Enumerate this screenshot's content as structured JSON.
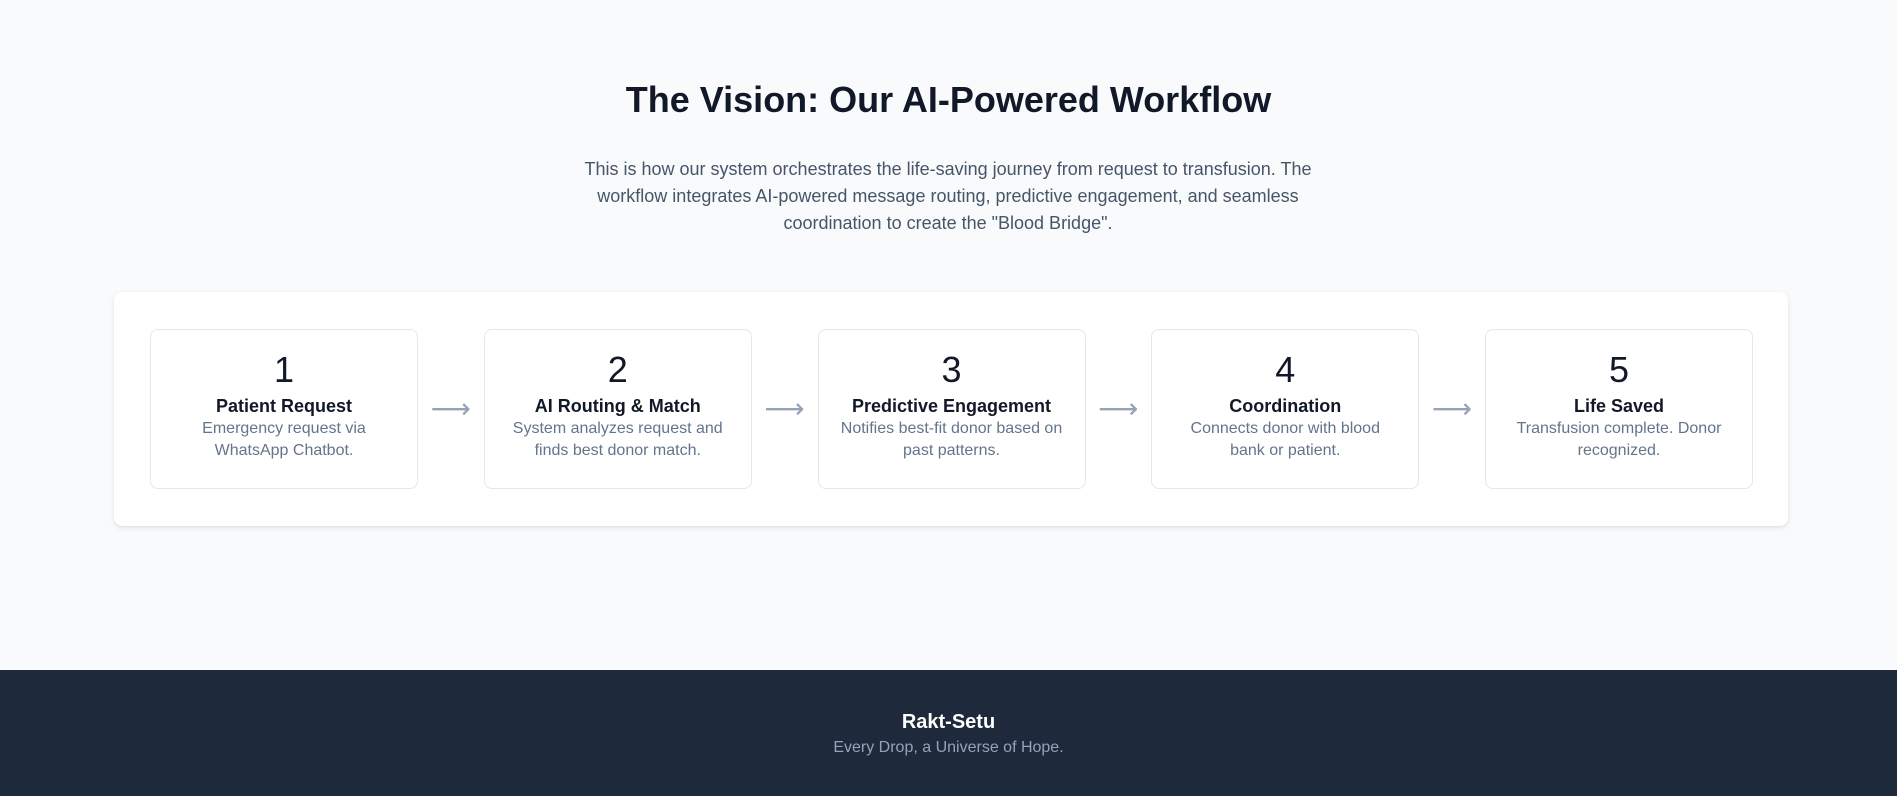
{
  "workflow": {
    "title": "The Vision: Our AI-Powered Workflow",
    "description": "This is how our system orchestrates the life-saving journey from request to transfusion. The workflow integrates AI-powered message routing, predictive engagement, and seamless coordination to create the \"Blood Bridge\".",
    "arrow_glyph": "⟶",
    "steps": [
      {
        "number": "1",
        "title": "Patient Request",
        "text": "Emergency request via WhatsApp Chatbot."
      },
      {
        "number": "2",
        "title": "AI Routing & Match",
        "text": "System analyzes request and finds best donor match."
      },
      {
        "number": "3",
        "title": "Predictive Engagement",
        "text": "Notifies best-fit donor based on past patterns."
      },
      {
        "number": "4",
        "title": "Coordination",
        "text": "Connects donor with blood bank or patient."
      },
      {
        "number": "5",
        "title": "Life Saved",
        "text": "Transfusion complete. Donor recognized."
      }
    ]
  },
  "footer": {
    "brand": "Rakt-Setu",
    "tagline": "Every Drop, a Universe of Hope."
  },
  "colors": {
    "page_background": "#f8fafc",
    "footer_background": "#1e293b",
    "heading": "#111827",
    "muted_text": "#64748b",
    "card_border": "#e2e8f0"
  }
}
